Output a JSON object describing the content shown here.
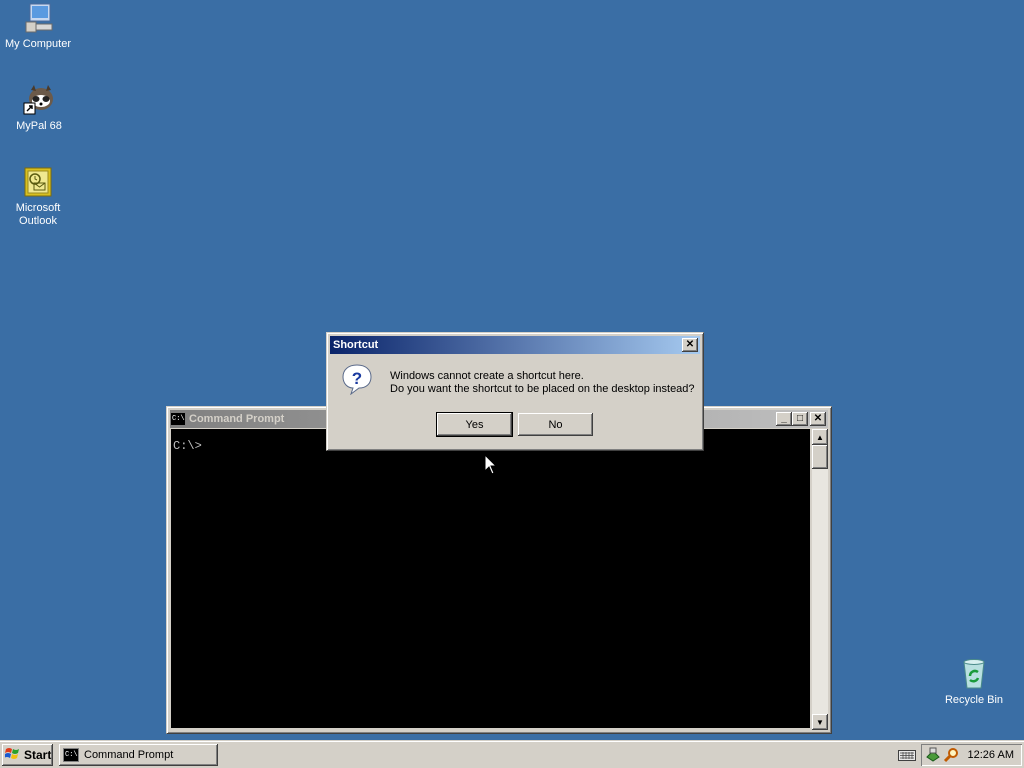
{
  "desktop": {
    "icons": [
      {
        "label": "My Computer"
      },
      {
        "label": "MyPal 68"
      },
      {
        "label": "Microsoft Outlook"
      },
      {
        "label": "Recycle Bin"
      }
    ]
  },
  "cmd_window": {
    "title": "Command Prompt",
    "icon_text": "C:\\",
    "prompt": "C:\\>"
  },
  "dialog": {
    "title": "Shortcut",
    "line1": "Windows cannot create a shortcut here.",
    "line2": "Do you want the shortcut to be placed on the desktop instead?",
    "yes_label": "Yes",
    "no_label": "No"
  },
  "taskbar": {
    "start_label": "Start",
    "task_label": "Command Prompt",
    "clock": "12:26 AM"
  },
  "colors": {
    "desktop": "#3a6ea5",
    "active_title": "#0a246a",
    "inactive_title": "#808080"
  }
}
